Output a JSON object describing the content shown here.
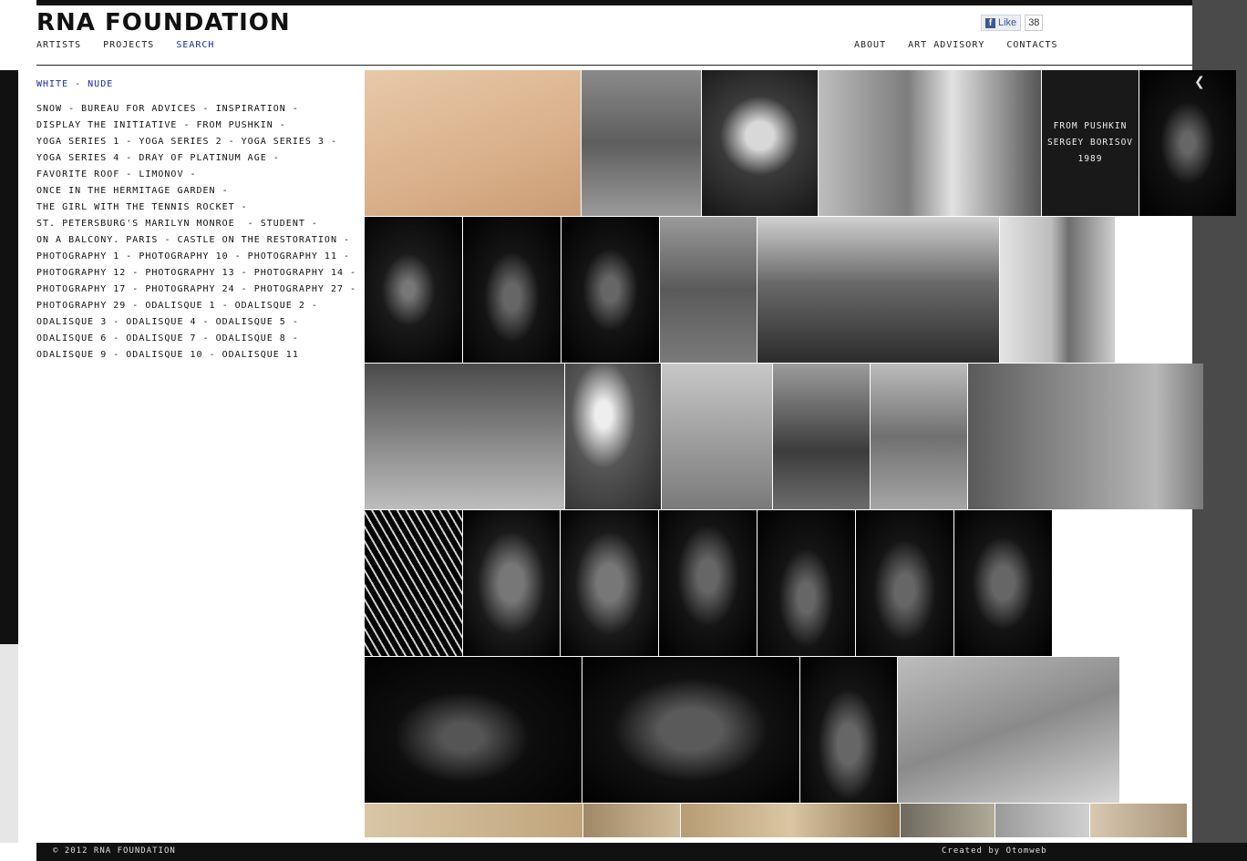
{
  "header": {
    "logo": "RNA FOUNDATION",
    "nav_left": [
      "ARTISTS",
      "PROJECTS",
      "SEARCH"
    ],
    "nav_right": [
      "ABOUT",
      "ART ADVISORY",
      "CONTACTS"
    ],
    "fb_like_label": "Like",
    "fb_like_count": "38"
  },
  "breadcrumb": "WHITE - NUDE",
  "projects_text": "SNOW - BUREAU FOR ADVICES - INSPIRATION -\nDISPLAY THE INITIATIVE - FROM PUSHKIN -\nYOGA SERIES 1 - YOGA SERIES 2 - YOGA SERIES 3 -\nYOGA SERIES 4 - DRAY OF PLATINUM AGE -\nFAVORITE ROOF - LIMONOV -\nONCE IN THE HERMITAGE GARDEN -\nTHE GIRL WITH THE TENNIS ROCKET -\nST. PETERSBURG'S MARILYN MONROE  - STUDENT -\nON A BALCONY. PARIS - CASTLE ON THE RESTORATION -\nPHOTOGRAPHY 1 - PHOTOGRAPHY 10 - PHOTOGRAPHY 11 -\nPHOTOGRAPHY 12 - PHOTOGRAPHY 13 - PHOTOGRAPHY 14 -\nPHOTOGRAPHY 17 - PHOTOGRAPHY 24 - PHOTOGRAPHY 27 -\nPHOTOGRAPHY 29 - ODALISQUE 1 - ODALISQUE 2 -\nODALISQUE 3 - ODALISQUE 4 - ODALISQUE 5 -\nODALISQUE 6 - ODALISQUE 7 - ODALISQUE 8 -\nODALISQUE 9 - ODALISQUE 10 - ODALISQUE 11",
  "hover_caption": {
    "line1": "FROM PUSHKIN",
    "line2": "SERGEY BORISOV",
    "line3": "1989"
  },
  "footer": {
    "copyright": "© 2012 RNA FOUNDATION",
    "credit": "Created by Otomweb"
  },
  "icons": {
    "prev": "chevron-left-icon"
  },
  "colors": {
    "accent_link": "#1a2aa6",
    "bar": "#111111"
  }
}
